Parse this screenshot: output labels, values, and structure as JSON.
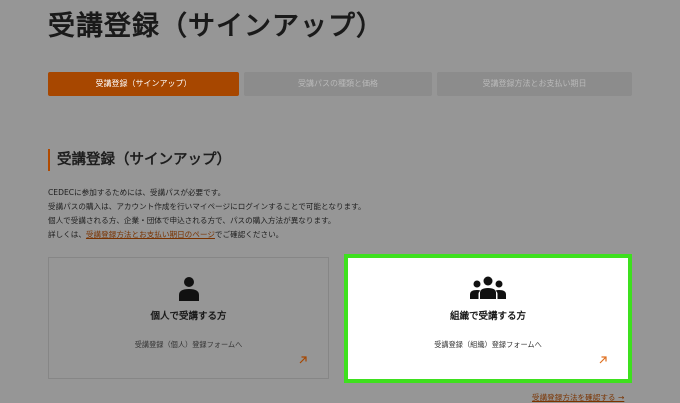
{
  "page_title": "受講登録（サインアップ）",
  "steps": [
    {
      "label": "受講登録（サインアップ）",
      "state": "active"
    },
    {
      "label": "受講パスの種類と価格",
      "state": "inactive"
    },
    {
      "label": "受講登録方法とお支払い期日",
      "state": "inactive"
    }
  ],
  "section_title": "受講登録（サインアップ）",
  "intro": {
    "line1": "CEDECに参加するためには、受講パスが必要です。",
    "line2": "受講パスの購入は、アカウント作成を行いマイページにログインすることで可能となります。",
    "line3": "個人で受講される方、企業・団体で申込される方で、パスの購入方法が異なります。",
    "line4_prefix": "詳しくは、",
    "line4_link": "受講登録方法とお支払い期日のページ",
    "line4_suffix": "でご確認ください。"
  },
  "cards": {
    "individual": {
      "title": "個人で受講する方",
      "subtitle": "受講登録（個人）登録フォームへ",
      "icon": "person-icon"
    },
    "organization": {
      "title": "組織で受講する方",
      "subtitle": "受講登録（組織）登録フォームへ",
      "icon": "group-icon"
    }
  },
  "bottom_link": "受講登録方法を確認する →",
  "colors": {
    "accent": "#a74700",
    "highlight": "#3ee01e",
    "overlay": "#969696"
  }
}
